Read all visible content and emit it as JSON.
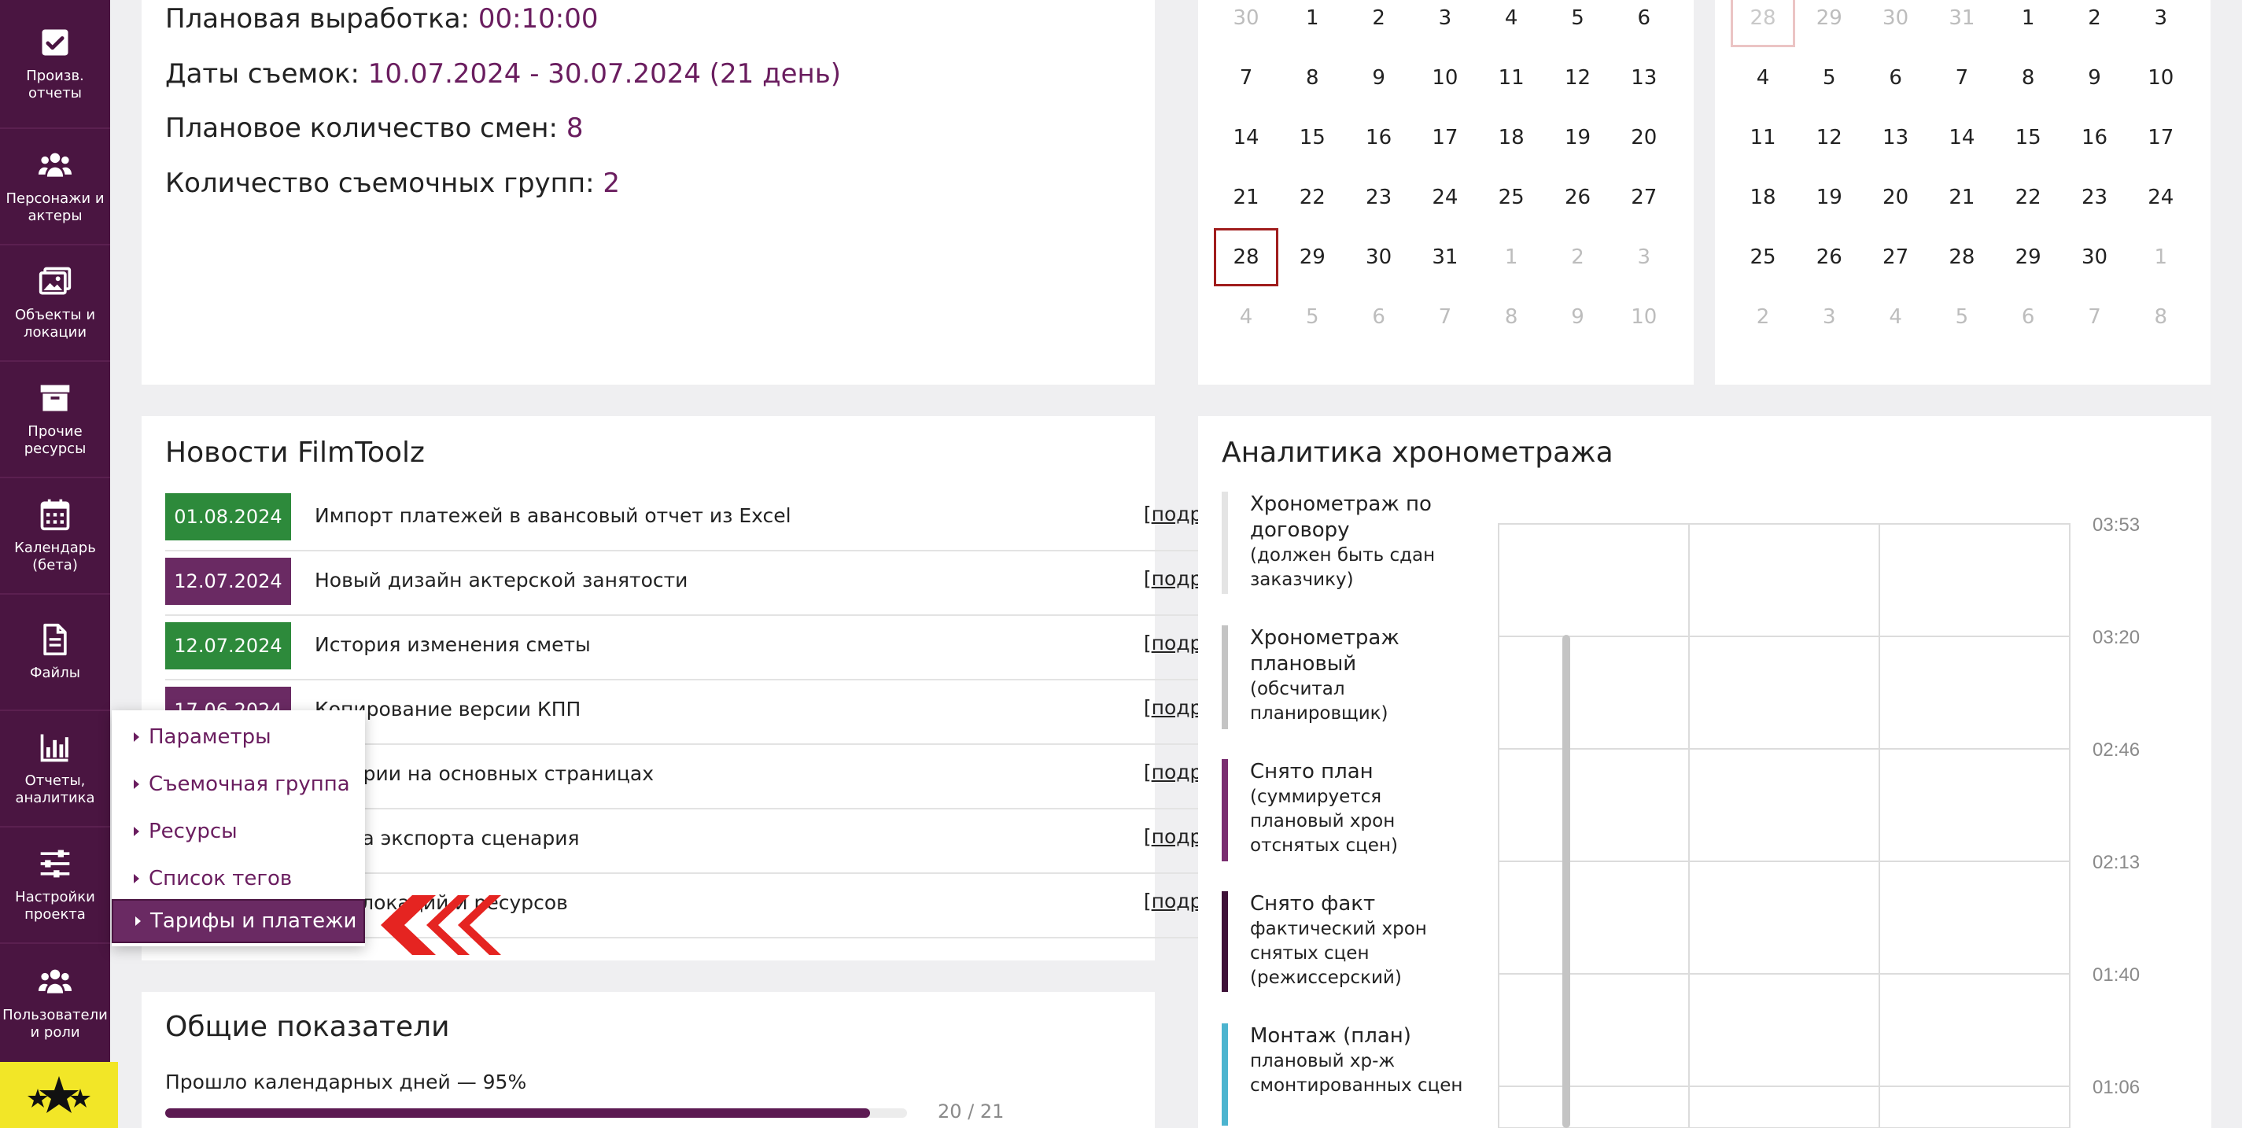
{
  "sidebar": {
    "items": [
      {
        "label": "Произв. отчеты",
        "icon": "checkbox-icon"
      },
      {
        "label": "Персонажи и актеры",
        "icon": "people-icon"
      },
      {
        "label": "Объекты и локации",
        "icon": "image-icon"
      },
      {
        "label": "Прочие ресурсы",
        "icon": "archive-box-icon"
      },
      {
        "label": "Календарь (бета)",
        "icon": "calendar-icon"
      },
      {
        "label": "Файлы",
        "icon": "file-icon"
      },
      {
        "label": "Отчеты, аналитика",
        "icon": "bar-chart-icon"
      },
      {
        "label": "Настройки проекта",
        "icon": "sliders-icon"
      },
      {
        "label": "Пользователи и роли",
        "icon": "users-icon"
      }
    ],
    "bottom_icon": "stars-icon"
  },
  "project_info": {
    "planned_output_label": "Плановая выработка: ",
    "planned_output_value": "00:10:00",
    "shoot_dates_label": "Даты съемок: ",
    "shoot_dates_value": "10.07.2024 - 30.07.2024 (21 день)",
    "planned_shifts_label": "Плановое количество смен: ",
    "planned_shifts_value": "8",
    "groups_label": "Количество съемочных групп: ",
    "groups_value": "2"
  },
  "calendar_left": {
    "weeks": [
      [
        "30",
        "1",
        "2",
        "3",
        "4",
        "5",
        "6"
      ],
      [
        "7",
        "8",
        "9",
        "10",
        "11",
        "12",
        "13"
      ],
      [
        "14",
        "15",
        "16",
        "17",
        "18",
        "19",
        "20"
      ],
      [
        "21",
        "22",
        "23",
        "24",
        "25",
        "26",
        "27"
      ],
      [
        "28",
        "29",
        "30",
        "31",
        "1",
        "2",
        "3"
      ],
      [
        "4",
        "5",
        "6",
        "7",
        "8",
        "9",
        "10"
      ]
    ]
  },
  "calendar_right": {
    "weeks": [
      [
        "28",
        "29",
        "30",
        "31",
        "1",
        "2",
        "3"
      ],
      [
        "4",
        "5",
        "6",
        "7",
        "8",
        "9",
        "10"
      ],
      [
        "11",
        "12",
        "13",
        "14",
        "15",
        "16",
        "17"
      ],
      [
        "18",
        "19",
        "20",
        "21",
        "22",
        "23",
        "24"
      ],
      [
        "25",
        "26",
        "27",
        "28",
        "29",
        "30",
        "1"
      ],
      [
        "2",
        "3",
        "4",
        "5",
        "6",
        "7",
        "8"
      ]
    ]
  },
  "news": {
    "title": "Новости FilmToolz",
    "more_label": "подробнее",
    "items": [
      {
        "date": "01.08.2024",
        "color": "green",
        "text": "Импорт платежей в авансовый отчет из Excel"
      },
      {
        "date": "12.07.2024",
        "color": "purple",
        "text": "Новый дизайн актерской занятости"
      },
      {
        "date": "12.07.2024",
        "color": "green",
        "text": "История изменения сметы"
      },
      {
        "date": "17.06.2024",
        "color": "purple",
        "text": "Копирование версии КПП"
      },
      {
        "date": "",
        "color": "purple",
        "text": "ентарии на основных страницах"
      },
      {
        "date": "",
        "color": "green",
        "text": "ботка экспорта сценария"
      },
      {
        "date": "",
        "color": "purple",
        "text": "ет з          локаций и ресурсов"
      }
    ]
  },
  "popup_menu": {
    "items": [
      {
        "label": "Параметры",
        "active": false
      },
      {
        "label": "Съемочная группа",
        "active": false
      },
      {
        "label": "Ресурсы",
        "active": false
      },
      {
        "label": "Список тегов",
        "active": false
      },
      {
        "label": "Тарифы и платежи",
        "active": true
      }
    ]
  },
  "totals": {
    "title": "Общие показатели",
    "days_label": "Прошло календарных дней — 95%",
    "days_fraction": 0.95,
    "days_count": "20 / 21"
  },
  "analytics": {
    "title": "Аналитика хронометража",
    "legend": [
      {
        "title": "Хронометраж по договору",
        "sub": "(должен быть сдан заказчику)",
        "color": "#e4e4e4"
      },
      {
        "title": "Хронометраж плановый",
        "sub": "(обсчитал планировщик)",
        "color": "#c4c4c4"
      },
      {
        "title": "Снято план",
        "sub": "(суммируется плановый хрон отснятых сцен)",
        "color": "#7a2e71"
      },
      {
        "title": "Снято факт",
        "sub": "фактический хрон снятых сцен (режиссерский)",
        "color": "#3e1238"
      },
      {
        "title": "Монтаж (план)",
        "sub": "плановый хр-ж смонтированных сцен",
        "color": "#4cb4cf"
      }
    ],
    "y_ticks": [
      "03:53",
      "03:20",
      "02:46",
      "02:13",
      "01:40",
      "01:06"
    ],
    "bar_color": "#c4c4c4"
  }
}
